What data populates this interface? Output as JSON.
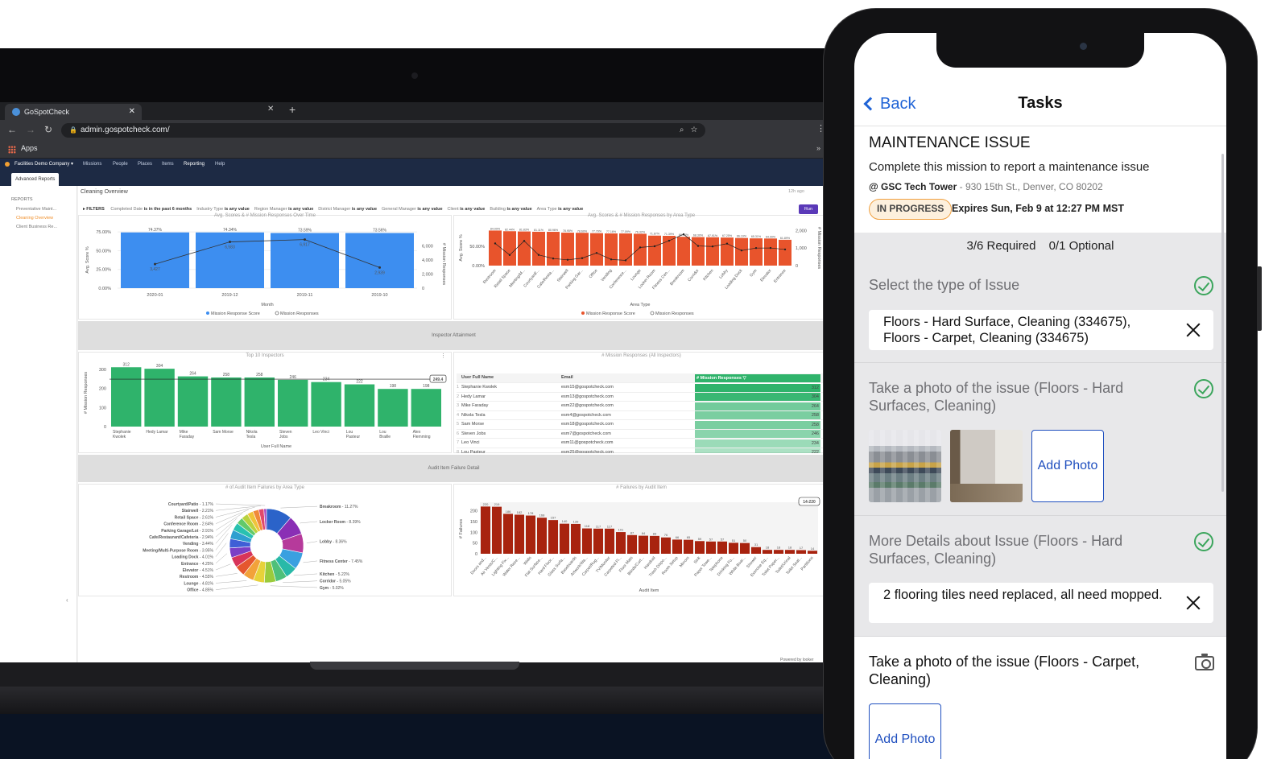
{
  "browser": {
    "tab_title": "GoSpotCheck",
    "url": "admin.gospotcheck.com/",
    "bookmark_apps": "Apps"
  },
  "app_nav": {
    "company": "Facilities Demo Company ▾",
    "items": [
      "Missions",
      "People",
      "Places",
      "Items",
      "Reporting",
      "Help"
    ],
    "active": "Reporting",
    "subtab": "Advanced Reports"
  },
  "sidebar": {
    "heading": "REPORTS",
    "items": [
      "Preventative Maint...",
      "Cleaning Overview",
      "Client Business Re..."
    ],
    "active": "Cleaning Overview"
  },
  "report": {
    "title": "Cleaning Overview",
    "updated": "12h ago",
    "filters_label": "FILTERS",
    "filters": [
      {
        "name": "Completed Date",
        "op": "is in the past 6 months"
      },
      {
        "name": "Industry Type",
        "op": "is any value"
      },
      {
        "name": "Region Manager",
        "op": "is any value"
      },
      {
        "name": "District Manager",
        "op": "is any value"
      },
      {
        "name": "General Manager",
        "op": "is any value"
      },
      {
        "name": "Client",
        "op": "is any value"
      },
      {
        "name": "Building",
        "op": "is any value"
      },
      {
        "name": "Area Type",
        "op": "is any value"
      }
    ],
    "run_label": "Run",
    "section_inspector": "Inspector Attainment",
    "section_audit": "Audit Item Failure Detail",
    "powered_by": "Powered by looker"
  },
  "chart_data": [
    {
      "type": "bar",
      "title": "Avg. Scores & # Mission Responses Over Time",
      "categories": [
        "2020-01",
        "2019-12",
        "2019-11",
        "2019-10"
      ],
      "series": [
        {
          "name": "Mission Response Score",
          "values": [
            74.37,
            74.34,
            73.59,
            73.56
          ],
          "labels": [
            "74.37%",
            "74.34%",
            "73.59%",
            "73.56%"
          ],
          "color": "#3d8ef0"
        },
        {
          "name": "Mission Responses",
          "values": [
            3427,
            6583,
            6917,
            2939
          ],
          "type": "line"
        }
      ],
      "xlabel": "Month",
      "ylabel": "Avg. Score %",
      "y2label": "# Mission Responses",
      "yticks": [
        "75.00%",
        "50.00%",
        "25.00%",
        "0.00%"
      ],
      "y2ticks": [
        "6,000",
        "4,000",
        "2,000",
        "0"
      ]
    },
    {
      "type": "bar",
      "title": "Avg. Scores & # Mission Responses by Area Type",
      "categories": [
        "Restroom",
        "Retail Space",
        "Meeting/M...",
        "Courtyard/...",
        "Cafe/Resta...",
        "Stairwell",
        "Parking Gar...",
        "Office",
        "Vending",
        "Conference...",
        "Lounge",
        "Locker Room",
        "Fitness Cen...",
        "Breakroom",
        "Corridor",
        "Kitchen",
        "Lobby",
        "Loading Dock",
        "Gym",
        "Elevator",
        "Entrance"
      ],
      "series": [
        {
          "name": "Mission Response Score",
          "values": [
            84.09,
            82.44,
            81.83,
            81.11,
            80.96,
            78.95,
            78.6,
            77.79,
            77.16,
            77.09,
            76.32,
            71.87,
            71.39,
            69.04,
            68.3,
            67.91,
            67.25,
            66.19,
            65.31,
            64.99,
            61.89
          ],
          "color": "#e8542c"
        },
        {
          "name": "Mission Responses",
          "values": [
            1262,
            604,
            1404,
            610,
            403,
            330,
            424,
            720,
            354,
            300,
            1036,
            1100,
            1420,
            1785,
            1120,
            1090,
            1250,
            860,
            1000,
            1005,
            920
          ],
          "type": "line"
        }
      ],
      "xlabel": "Area Type",
      "ylabel": "Avg. Score %",
      "y2label": "# Mission Responses",
      "yticks": [
        "50.00%",
        "0.00%"
      ],
      "y2ticks": [
        "2,000",
        "1,000",
        "0"
      ]
    },
    {
      "type": "bar",
      "title": "Top 10 Inspectors",
      "categories": [
        "Stephanie Kwolek",
        "Hedy Lamar",
        "Mike Faraday",
        "Sam Morse",
        "Nikola Tesla",
        "Steven Jobs",
        "Leo Vinci",
        "Lou Pasteur",
        "Lou Braille",
        "Alex Flemming"
      ],
      "values": [
        312,
        304,
        264,
        258,
        258,
        246,
        234,
        222,
        198,
        198
      ],
      "reference_line": 249.4,
      "reference_label": "249.4",
      "xlabel": "User Full Name",
      "ylabel": "# Mission Responses",
      "yticks": [
        "300",
        "200",
        "100",
        "0"
      ],
      "color": "#2fb36b"
    },
    {
      "type": "table",
      "title": "# Mission Responses (All Inspectors)",
      "columns": [
        "User Full Name",
        "Email",
        "# Mission Responses ▽"
      ],
      "rows": [
        [
          "Stephanie Kwolek",
          "esm15@gospotcheck.com",
          "312"
        ],
        [
          "Hedy Lamar",
          "esm13@gospotcheck.com",
          "304"
        ],
        [
          "Mike Faraday",
          "esm22@gospotcheck.com",
          "264"
        ],
        [
          "Nikola Tesla",
          "esm4@gospotcheck.com",
          "258"
        ],
        [
          "Sam Morse",
          "esm18@gospotcheck.com",
          "258"
        ],
        [
          "Steven Jobs",
          "esm7@gospotcheck.com",
          "246"
        ],
        [
          "Leo Vinci",
          "esm11@gospotcheck.com",
          "234"
        ],
        [
          "Lou Pasteur",
          "esm25@gospotcheck.com",
          "222"
        ]
      ]
    },
    {
      "type": "pie",
      "title": "# of Audit Item Failures by Area Type",
      "slices": [
        {
          "label": "Breakroom",
          "value": 11.27,
          "text": "Breakroom - 11.27%",
          "color": "#2b63c9"
        },
        {
          "label": "Locker Room",
          "value": 8.39,
          "text": "Locker Room - 8.39%",
          "color": "#8a2fb5"
        },
        {
          "label": "Lobby",
          "value": 8.36,
          "text": "Lobby - 8.36%",
          "color": "#b63a9b"
        },
        {
          "label": "Fitness Center",
          "value": 7.45,
          "text": "Fitness Center - 7.45%",
          "color": "#3aa0e0"
        },
        {
          "label": "Kitchen",
          "value": 5.22,
          "text": "Kitchen - 5.22%",
          "color": "#29b9a8"
        },
        {
          "label": "Corridor",
          "value": 5.05,
          "text": "Corridor - 5.05%",
          "color": "#4fc07a"
        },
        {
          "label": "Gym",
          "value": 5.02,
          "text": "Gym - 5.02%",
          "color": "#9bcb3c"
        },
        {
          "label": "Office",
          "value": 4.85,
          "text": "Office - 4.85%",
          "color": "#e7d23a"
        },
        {
          "label": "Lounge",
          "value": 4.81,
          "text": "Lounge - 4.81%",
          "color": "#f2a23a"
        },
        {
          "label": "Restroom",
          "value": 4.55,
          "text": "Restroom - 4.55%",
          "color": "#e5572e"
        },
        {
          "label": "Elevator",
          "value": 4.51,
          "text": "Elevator - 4.51%",
          "color": "#d8345a"
        },
        {
          "label": "Entrance",
          "value": 4.25,
          "text": "Entrance - 4.25%",
          "color": "#7b3fc6"
        },
        {
          "label": "Loading Dock",
          "value": 4.01,
          "text": "Loading Dock - 4.01%",
          "color": "#3f5fd6"
        },
        {
          "label": "Meeting/Multi-Purpose Room",
          "value": 3.95,
          "text": "Meeting/Multi-Purpose Room - 3.95%",
          "color": "#2f9fd0"
        },
        {
          "label": "Vending",
          "value": 3.44,
          "text": "Vending - 3.44%",
          "color": "#28c1b0"
        },
        {
          "label": "Cafe/Restaurant/Cafeteria",
          "value": 2.94,
          "text": "Cafe/Restaurant/Cafeteria - 2.94%",
          "color": "#62c96a"
        },
        {
          "label": "Parking Garage/Lot",
          "value": 2.91,
          "text": "Parking Garage/Lot - 2.91%",
          "color": "#b9d23e"
        },
        {
          "label": "Conference Room",
          "value": 2.64,
          "text": "Conference Room - 2.64%",
          "color": "#f0c43a"
        },
        {
          "label": "Retail Space",
          "value": 2.61,
          "text": "Retail Space - 2.61%",
          "color": "#f08a3a"
        },
        {
          "label": "Stairwell",
          "value": 2.21,
          "text": "Stairwell - 2.21%",
          "color": "#e04a6a"
        },
        {
          "label": "Courtyard/Patio",
          "value": 1.17,
          "text": "Courtyard/Patio - 1.17%",
          "color": "#a94bc0"
        }
      ]
    },
    {
      "type": "bar",
      "title": "# Failures by Audit Item",
      "categories": [
        "Doors and...",
        "Air Vents/C...",
        "Lighting Fix...",
        "Water Rece...",
        "Walls",
        "Flat Surface...",
        "Hard Floor...",
        "Glass Surfa...",
        "Baseboards",
        "Artwork/Wa...",
        "Carpet/Rug...",
        "TV/Monitor",
        "Carpeted Fl...",
        "Floor Mats",
        "Blinds/Curt...",
        "Handrail",
        "Trash Dispo...",
        "Room Setup",
        "Mirrors",
        "Sink",
        "Paper Towe...",
        "Telephone",
        "Drinking Fo...",
        "White Boar...",
        "Shower",
        "Exercise Eq...",
        "Toilet Paper...",
        "Toilet/Urinal",
        "Toilet Seat...",
        "Partitions"
      ],
      "values": [
        220,
        219,
        186,
        182,
        178,
        168,
        157,
        140,
        139,
        118,
        117,
        117,
        101,
        87,
        84,
        83,
        76,
        66,
        65,
        59,
        57,
        57,
        51,
        50,
        31,
        18,
        18,
        18,
        17,
        14
      ],
      "badge": "14-220",
      "xlabel": "Audit Item",
      "ylabel": "# Failures",
      "yticks": [
        "200",
        "150",
        "100",
        "50",
        "0"
      ],
      "color": "#a8230f"
    }
  ],
  "phone": {
    "nav_back": "Back",
    "nav_title": "Tasks",
    "mission_title": "MAINTENANCE ISSUE",
    "mission_desc": "Complete this mission to report a maintenance issue",
    "location_name": "@ GSC Tech Tower",
    "location_addr": "- 930 15th St., Denver, CO 80202",
    "status": "IN PROGRESS",
    "expires": "Expires Sun, Feb 9 at 12:27 PM MST",
    "required": "3/6 Required",
    "optional": "0/1 Optional",
    "questions": [
      {
        "text": "Select the type of Issue",
        "answer": "Floors - Hard Surface, Cleaning (334675), Floors - Carpet, Cleaning (334675)"
      },
      {
        "text": "Take a photo of the issue (Floors - Hard Surfaces, Cleaning)",
        "add_photo": "Add Photo"
      },
      {
        "text": "More Details about Issue (Floors - Hard Surfaces, Cleaning)",
        "answer": "2 flooring tiles need replaced, all need mopped."
      },
      {
        "text": "Take a photo of the issue (Floors - Carpet, Cleaning)",
        "add_photo": "Add Photo"
      }
    ]
  }
}
